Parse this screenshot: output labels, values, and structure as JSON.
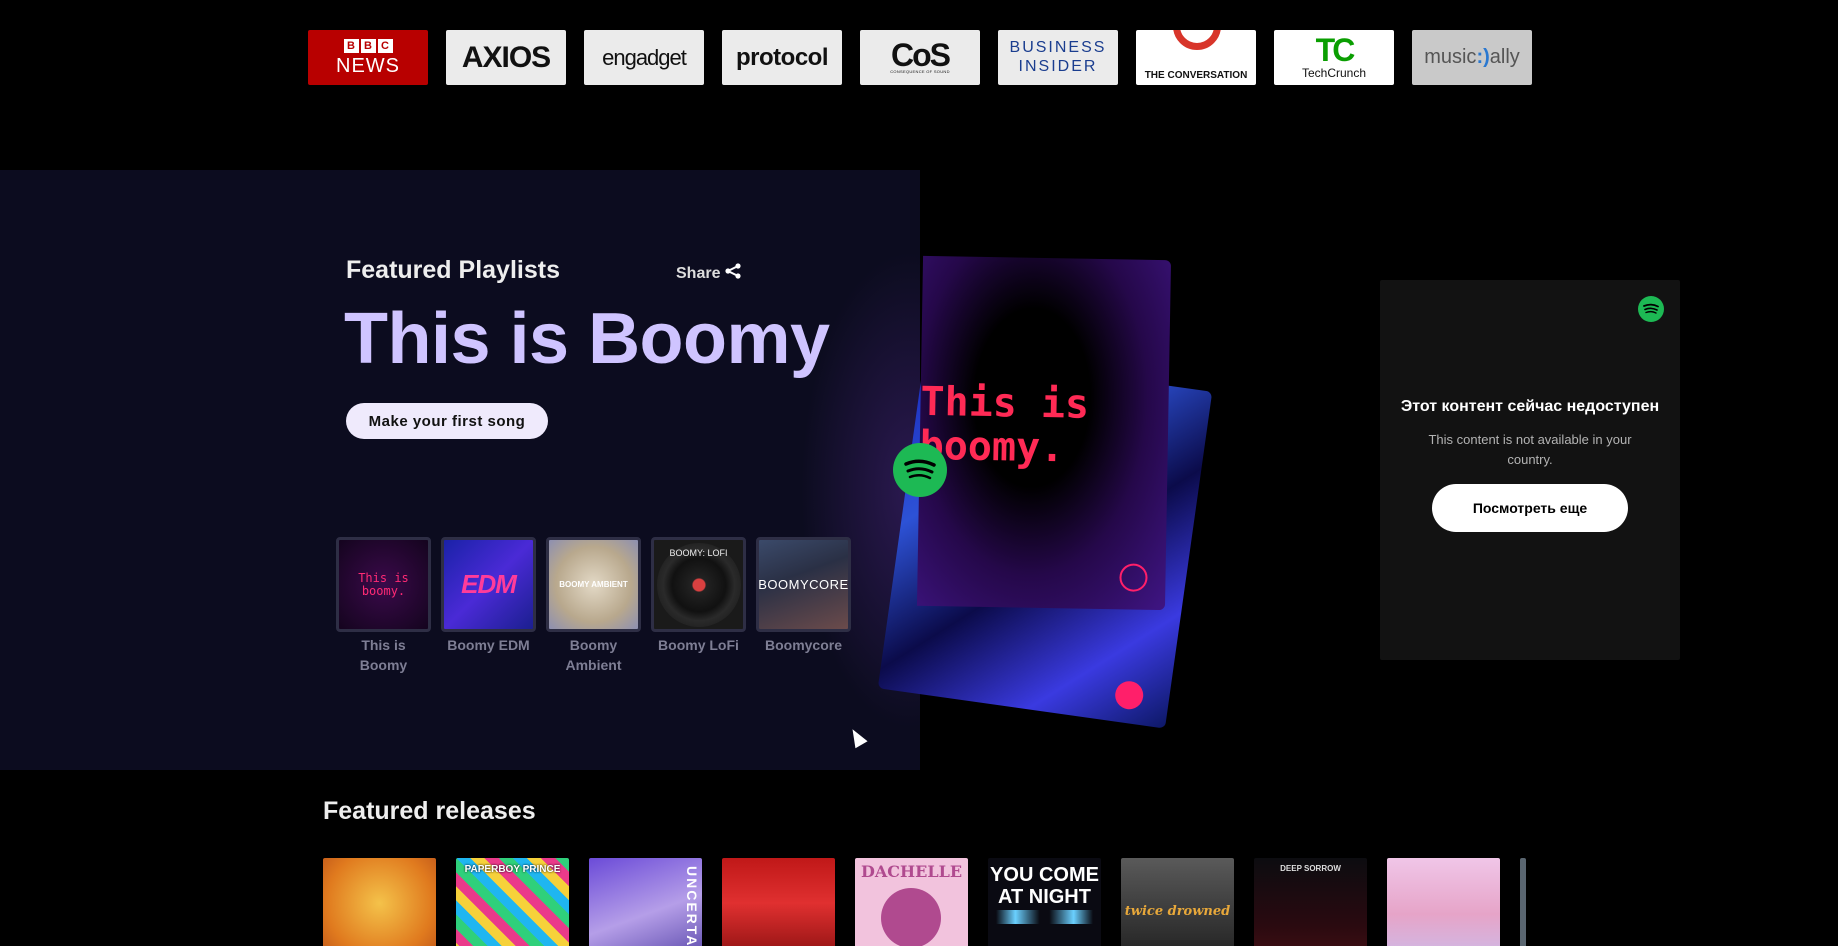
{
  "press_logos": [
    {
      "name": "bbc-news",
      "line1": "BBC",
      "line2": "NEWS"
    },
    {
      "name": "axios",
      "text": "AXIOS"
    },
    {
      "name": "engadget",
      "text": "engadget"
    },
    {
      "name": "protocol",
      "text": "protocol"
    },
    {
      "name": "consequence-of-sound",
      "text": "CoS",
      "sub": "CONSEQUENCE OF SOUND"
    },
    {
      "name": "business-insider",
      "line1": "BUSINESS",
      "line2": "INSIDER"
    },
    {
      "name": "the-conversation",
      "text": "THE CONVERSATION"
    },
    {
      "name": "techcrunch",
      "mark": "TC",
      "text": "TechCrunch"
    },
    {
      "name": "music-ally",
      "text_a": "music",
      "text_b": ":)",
      "text_c": "ally"
    }
  ],
  "featured_playlists": {
    "section_title": "Featured Playlists",
    "share_label": "Share",
    "hero_title": "This is Boomy",
    "cta_label": "Make your first song",
    "playlists": [
      {
        "label": "This is Boomy",
        "art_text": "This is\nboomy."
      },
      {
        "label": "Boomy EDM",
        "art_text": "EDM"
      },
      {
        "label": "Boomy Ambient",
        "art_text": "BOOMY AMBIENT"
      },
      {
        "label": "Boomy LoFi",
        "art_text": "BOOMY: LOFI"
      },
      {
        "label": "Boomycore",
        "art_text": "BOOMYCORE"
      }
    ],
    "cover_text": "This is\nboomy."
  },
  "spotify_embed": {
    "heading": "Этот контент сейчас недоступен",
    "message": "This content is not available in your country.",
    "button_label": "Посмотреть еще"
  },
  "featured_releases": {
    "section_title": "Featured releases",
    "items": [
      {
        "name": "release-1",
        "caption": ""
      },
      {
        "name": "release-2",
        "caption": "PAPERBOY PRINCE"
      },
      {
        "name": "release-3",
        "caption": "UNCERTAIN"
      },
      {
        "name": "release-4",
        "caption": ""
      },
      {
        "name": "release-5",
        "caption": "DACHELLE"
      },
      {
        "name": "release-6",
        "caption": "YOU COME AT NIGHT"
      },
      {
        "name": "release-7",
        "caption": "twice drowned"
      },
      {
        "name": "release-8",
        "caption": "DEEP SORROW"
      },
      {
        "name": "release-9",
        "caption": ""
      }
    ]
  },
  "colors": {
    "hero_accent": "#cfc4ff",
    "spotify_green": "#1db954",
    "panel_bg": "#0c0c1f"
  }
}
